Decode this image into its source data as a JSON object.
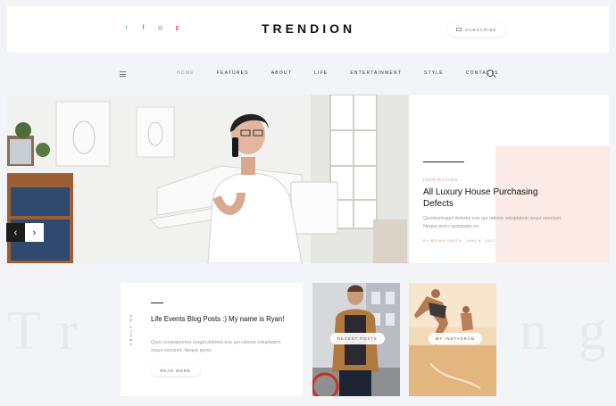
{
  "header": {
    "brand": "TRENDION",
    "subscribe_label": "SUBSCRIBE",
    "social": [
      {
        "icon": "twitter-icon",
        "glyph": "t",
        "color": "#2aa9e0"
      },
      {
        "icon": "facebook-icon",
        "glyph": "f",
        "color": "#3b5998"
      },
      {
        "icon": "instagram-icon",
        "glyph": "◎",
        "color": "#9a6b9b"
      },
      {
        "icon": "pinterest-icon",
        "glyph": "p",
        "color": "#cb2027"
      }
    ]
  },
  "nav": {
    "items": [
      "HOME",
      "FEATURES",
      "ABOUT",
      "LIFE",
      "ENTERTAINMENT",
      "STYLE",
      "CONTACTS"
    ],
    "active": "HOME"
  },
  "slider": {
    "prev_glyph": "‹",
    "next_glyph": "›"
  },
  "feature": {
    "category": "INSPIRATION",
    "title": "All Luxury House Purchasing Defects",
    "excerpt": "Quunturmagni dolores eos qui ratione voluptatem sequi nesciunt. Neque porro quisquam es.",
    "author": "BY BRIAN SMITH",
    "date": "MAY 8, 2017"
  },
  "background_text": {
    "left": [
      "T",
      "r"
    ],
    "right": [
      "n",
      "g"
    ]
  },
  "about": {
    "vertical_label": "ABOUT ME",
    "title": "Life Events Blog Posts :) My name is Ryan!",
    "excerpt": "Quia consequuntur magni dolores eos qui ratione voluptatem sequi nesciunt. Neque porro.",
    "read_more": "READ MORE"
  },
  "tiles": {
    "recent_posts": "RECENT POSTS",
    "instagram": "MY INSTAGRAM"
  },
  "colors": {
    "accent": "#d58e7e",
    "pink_block": "#fbeae6",
    "page_bg": "#f3f4f8"
  }
}
